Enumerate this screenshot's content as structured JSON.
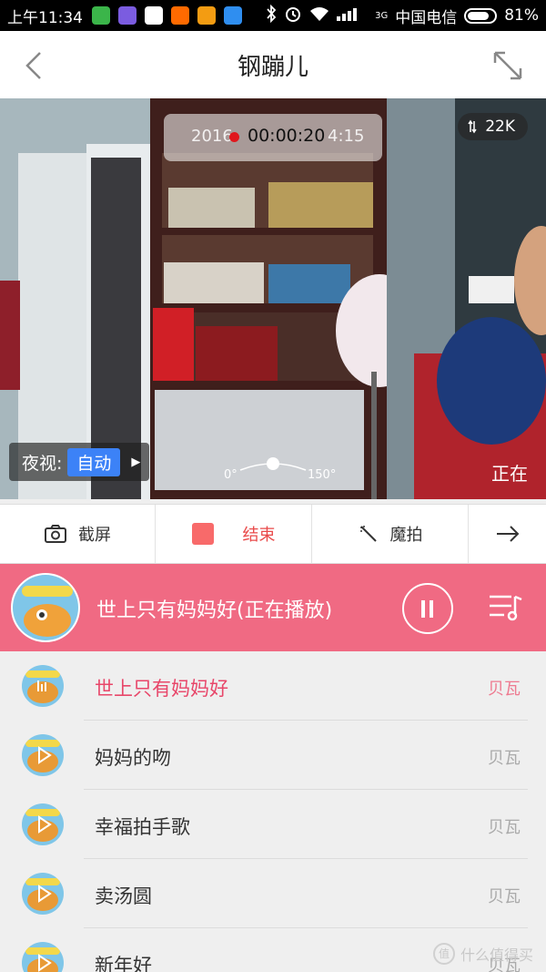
{
  "status_bar": {
    "time": "上午11:34",
    "network_type": "3G",
    "carrier": "中国电信",
    "battery_percent": "81%",
    "battery_level": 0.81
  },
  "header": {
    "title": "钢蹦儿"
  },
  "video": {
    "record_time": "00:00:20",
    "timestamp_partial_left": "2016",
    "timestamp_partial_right": "4:15",
    "bitrate": "22K",
    "night_vision_label": "夜视:",
    "night_vision_mode": "自动",
    "angle_min": "0°",
    "angle_max": "150°",
    "overlay_text": "正在"
  },
  "toolbar": {
    "screenshot_label": "截屏",
    "stop_label": "结束",
    "magic_label": "魔拍"
  },
  "now_playing": {
    "title": "世上只有妈妈好(正在播放)"
  },
  "songs": [
    {
      "name": "世上只有妈妈好",
      "artist": "贝瓦",
      "active": true
    },
    {
      "name": "妈妈的吻",
      "artist": "贝瓦",
      "active": false
    },
    {
      "name": "幸福拍手歌",
      "artist": "贝瓦",
      "active": false
    },
    {
      "name": "卖汤圆",
      "artist": "贝瓦",
      "active": false
    },
    {
      "name": "新年好",
      "artist": "贝瓦",
      "active": false
    }
  ],
  "watermark": {
    "text": "什么值得买",
    "badge": "值"
  },
  "colors": {
    "accent_pink": "#f06a83",
    "active_song": "#e8476a",
    "night_mode_blue": "#3c82f7",
    "record_red": "#e0171d",
    "stop_red": "#f86a6a"
  }
}
